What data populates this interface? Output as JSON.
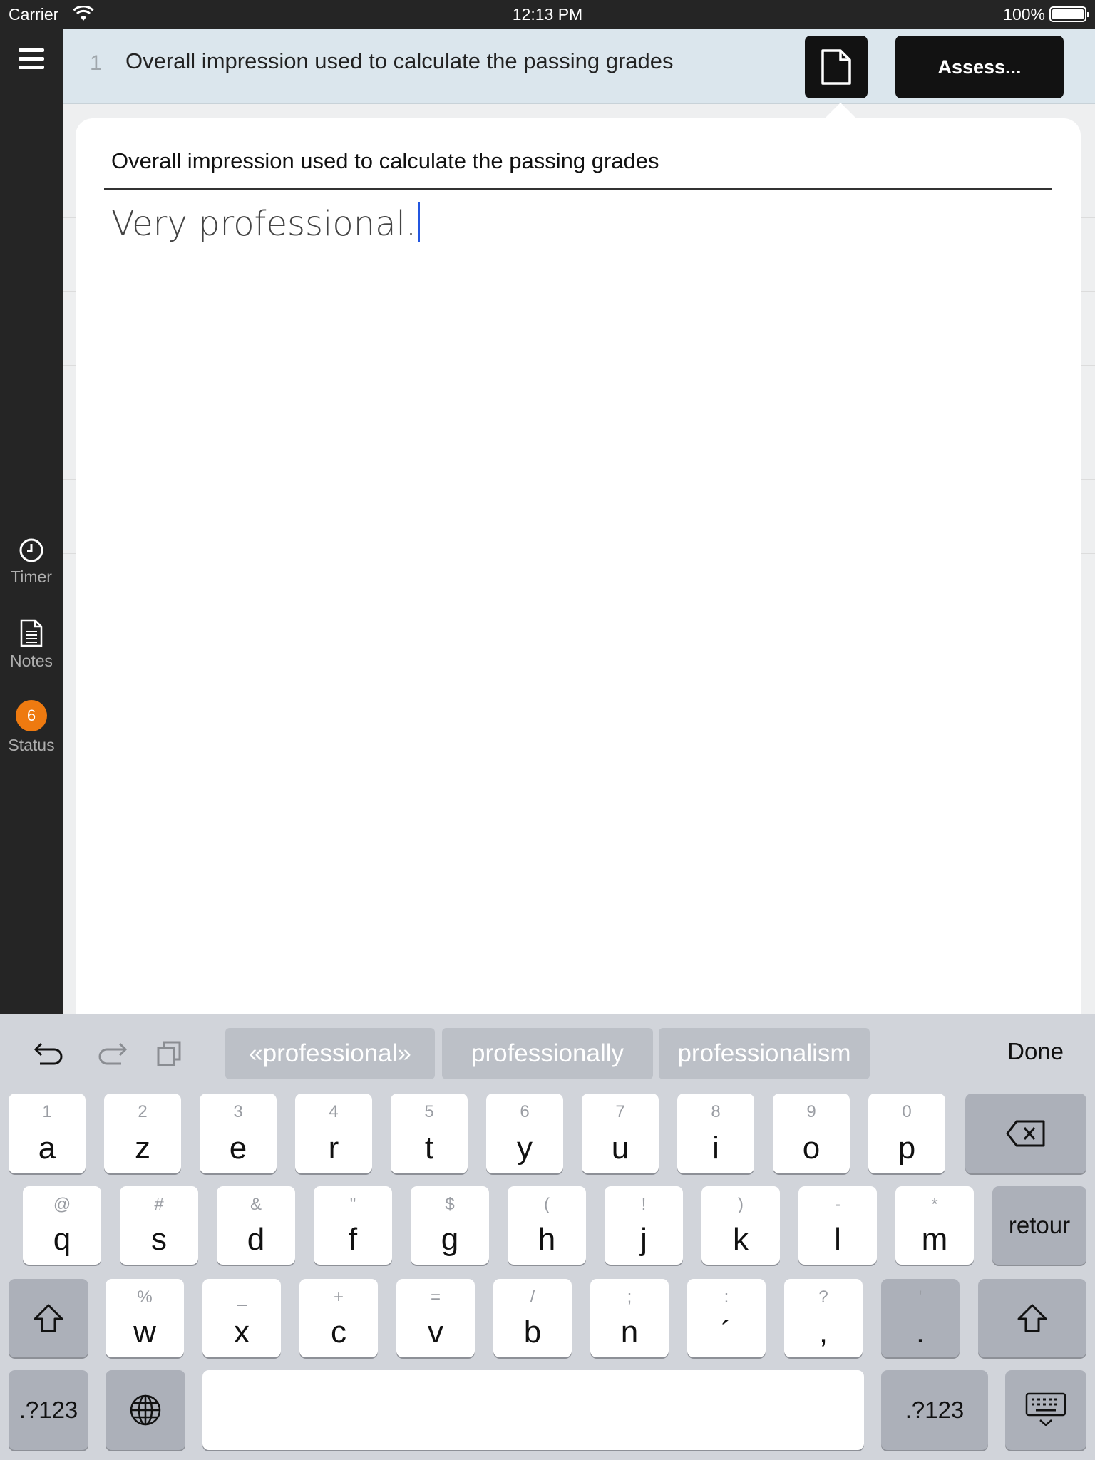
{
  "status_bar": {
    "carrier": "Carrier",
    "time": "12:13 PM",
    "battery": "100%"
  },
  "sidebar": {
    "timer_label": "Timer",
    "notes_label": "Notes",
    "status_label": "Status",
    "status_count": "6"
  },
  "header": {
    "number": "1",
    "title": "Overall impression used to calculate the passing grades",
    "assess_label": "Assess..."
  },
  "popover": {
    "title": "Overall impression used to calculate the passing grades",
    "text": "Very professional."
  },
  "keyboard": {
    "suggestions": [
      "«professional»",
      "professionally",
      "professionalism"
    ],
    "done_label": "Done",
    "row1": [
      {
        "sec": "1",
        "pri": "a"
      },
      {
        "sec": "2",
        "pri": "z"
      },
      {
        "sec": "3",
        "pri": "e"
      },
      {
        "sec": "4",
        "pri": "r"
      },
      {
        "sec": "5",
        "pri": "t"
      },
      {
        "sec": "6",
        "pri": "y"
      },
      {
        "sec": "7",
        "pri": "u"
      },
      {
        "sec": "8",
        "pri": "i"
      },
      {
        "sec": "9",
        "pri": "o"
      },
      {
        "sec": "0",
        "pri": "p"
      }
    ],
    "row2": [
      {
        "sec": "@",
        "pri": "q"
      },
      {
        "sec": "#",
        "pri": "s"
      },
      {
        "sec": "&",
        "pri": "d"
      },
      {
        "sec": "\"",
        "pri": "f"
      },
      {
        "sec": "$",
        "pri": "g"
      },
      {
        "sec": "(",
        "pri": "h"
      },
      {
        "sec": "!",
        "pri": "j"
      },
      {
        "sec": ")",
        "pri": "k"
      },
      {
        "sec": "-",
        "pri": "l"
      },
      {
        "sec": "*",
        "pri": "m"
      }
    ],
    "return_label": "retour",
    "row3": [
      {
        "sec": "%",
        "pri": "w"
      },
      {
        "sec": "_",
        "pri": "x"
      },
      {
        "sec": "+",
        "pri": "c"
      },
      {
        "sec": "=",
        "pri": "v"
      },
      {
        "sec": "/",
        "pri": "b"
      },
      {
        "sec": ";",
        "pri": "n"
      },
      {
        "sec": ":",
        "pri": "´"
      },
      {
        "sec": "?",
        "pri": ","
      },
      {
        "sec": "'",
        "pri": "."
      }
    ],
    "numbers_label": ".?123"
  }
}
